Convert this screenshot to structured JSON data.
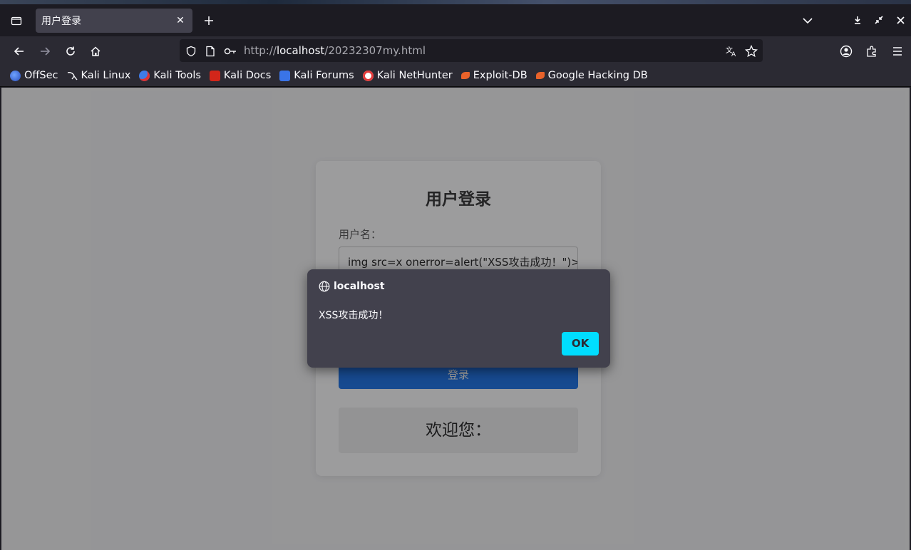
{
  "browser": {
    "tab": {
      "title": "用户登录",
      "close": "✕"
    },
    "url": {
      "prefix": "http://",
      "host": "localhost",
      "path": "/20232307my.html"
    },
    "bookmarks": [
      {
        "label": "OffSec",
        "icon": "offsec-icon",
        "color": "#3b6fd8"
      },
      {
        "label": "Kali Linux",
        "icon": "kali-linux-icon",
        "color": "#ffffff"
      },
      {
        "label": "Kali Tools",
        "icon": "kali-tools-icon",
        "color": "#3e7be6"
      },
      {
        "label": "Kali Docs",
        "icon": "kali-docs-icon",
        "color": "#d3261a"
      },
      {
        "label": "Kali Forums",
        "icon": "kali-forums-icon",
        "color": "#3a74e8"
      },
      {
        "label": "Kali NetHunter",
        "icon": "kali-nethunter-icon",
        "color": "#e23a3a"
      },
      {
        "label": "Exploit-DB",
        "icon": "exploit-db-icon",
        "color": "#e8622a"
      },
      {
        "label": "Google Hacking DB",
        "icon": "google-hacking-db-icon",
        "color": "#e8622a"
      }
    ]
  },
  "page": {
    "title": "用户登录",
    "username_label": "用户名：",
    "username_value": "img src=x onerror=alert(\"XSS攻击成功！\")>",
    "login_button": "登录",
    "welcome_text": "欢迎您："
  },
  "dialog": {
    "origin": "localhost",
    "message": "XSS攻击成功！",
    "ok_label": "OK",
    "ok_color": "#00ddff"
  }
}
